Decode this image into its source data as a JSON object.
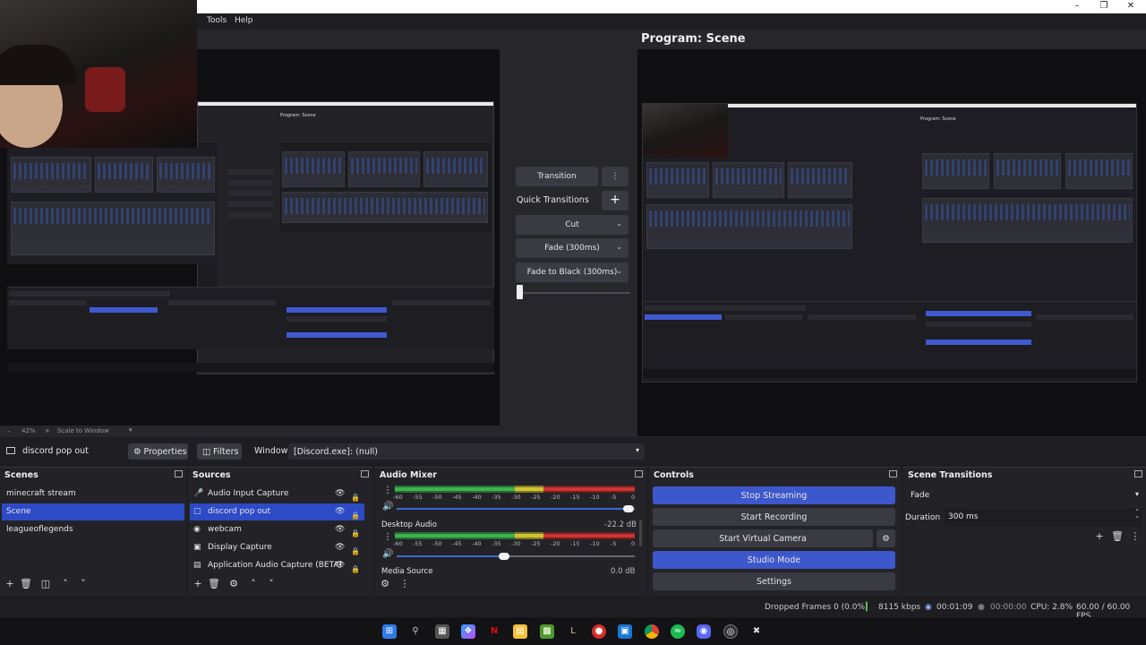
{
  "window": {
    "title": ""
  },
  "menu": {
    "items": [
      "Tools",
      "Help"
    ]
  },
  "preview": {
    "zoom": "42%",
    "zoom_mode": "Scale to Window"
  },
  "program": {
    "title": "Program: Scene"
  },
  "transitions_panel": {
    "transition_label": "Transition",
    "quick_transitions_label": "Quick Transitions",
    "items": [
      "Cut",
      "Fade (300ms)",
      "Fade to Black (300ms)"
    ]
  },
  "source_toolbar": {
    "source_name": "discord pop out",
    "properties_label": "Properties",
    "filters_label": "Filters",
    "window_label": "Window",
    "window_value": "[Discord.exe]: (null)"
  },
  "scenes": {
    "title": "Scenes",
    "items": [
      "minecraft stream",
      "Scene",
      "leagueoflegends"
    ],
    "selected": "Scene"
  },
  "sources": {
    "title": "Sources",
    "items": [
      "Audio Input Capture",
      "discord pop out",
      "webcam",
      "Display Capture",
      "Application Audio Capture (BETA)"
    ],
    "selected": "discord pop out"
  },
  "mixer": {
    "title": "Audio Mixer",
    "scale": [
      "-60",
      "-55",
      "-50",
      "-45",
      "-40",
      "-35",
      "-30",
      "-25",
      "-20",
      "-15",
      "-10",
      "-5",
      "0"
    ],
    "channels": [
      {
        "name": "",
        "level": ""
      },
      {
        "name": "Desktop Audio",
        "level": "-22.2 dB"
      },
      {
        "name": "Media Source",
        "level": "0.0 dB"
      }
    ]
  },
  "controls": {
    "title": "Controls",
    "stop_streaming": "Stop Streaming",
    "start_recording": "Start Recording",
    "start_virtual_camera": "Start Virtual Camera",
    "studio_mode": "Studio Mode",
    "settings": "Settings"
  },
  "scene_transitions": {
    "title": "Scene Transitions",
    "selected": "Fade",
    "duration_label": "Duration",
    "duration_value": "300 ms"
  },
  "status": {
    "dropped_frames": "Dropped Frames 0 (0.0%)",
    "bitrate": "8115 kbps",
    "stream_time": "00:01:09",
    "record_time": "00:00:00",
    "cpu": "CPU: 2.8%",
    "fps": "60.00 / 60.00 FPS"
  },
  "taskbar": {
    "icons": [
      "windows-start",
      "search",
      "file-manager",
      "copilot",
      "netflix",
      "folder",
      "minecraft",
      "league",
      "app-red",
      "app-blue",
      "chrome",
      "spotify",
      "discord",
      "obs",
      "app-x"
    ]
  },
  "colors": {
    "accent": "#3d57cc",
    "selected": "#2d4bc6",
    "background": "#1e1e22",
    "panel": "#232327"
  }
}
